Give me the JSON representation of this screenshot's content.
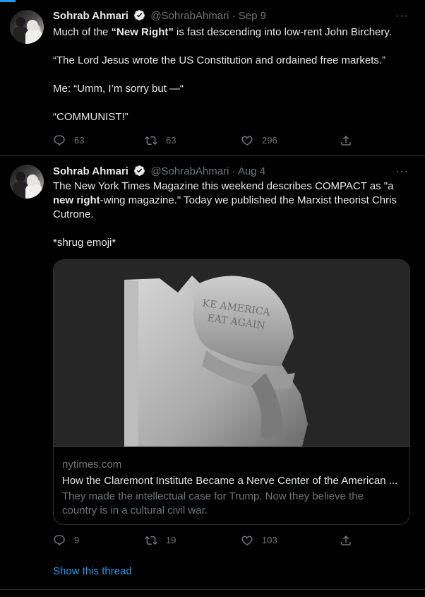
{
  "tweets": [
    {
      "author_name": "Sohrab Ahmari",
      "handle": "@SohrabAhmari",
      "separator": "·",
      "date": "Sep 9",
      "lines": [
        {
          "pre": "Much of the ",
          "bold": "“New Right”",
          "post": " is fast descending into low-rent John Birchery."
        },
        {
          "pre": "“The Lord Jesus wrote the US Constitution and ordained free markets.”",
          "bold": "",
          "post": ""
        },
        {
          "pre": "Me: “Umm, I’m sorry but —“",
          "bold": "",
          "post": ""
        },
        {
          "pre": "“COMMUNIST!”",
          "bold": "",
          "post": ""
        }
      ],
      "reply_count": "63",
      "retweet_count": "63",
      "like_count": "296"
    },
    {
      "author_name": "Sohrab Ahmari",
      "handle": "@SohrabAhmari",
      "separator": "·",
      "date": "Aug 4",
      "text_part1": "The New York Times Magazine this weekend describes COMPACT as \"a ",
      "text_bold": "new right",
      "text_part2": "-wing magazine.\" Today we published the Marxist theorist Chris Cutrone.",
      "text_line2": "*shrug emoji*",
      "card": {
        "image_caption": "KE AMERICA\nEAT AGAIN",
        "domain": "nytimes.com",
        "title": "How the Claremont Institute Became a Nerve Center of the American ...",
        "description": "They made the intellectual case for Trump. Now they believe the country is in a cultural civil war."
      },
      "reply_count": "9",
      "retweet_count": "19",
      "like_count": "103"
    }
  ],
  "show_thread_label": "Show this thread",
  "colors": {
    "background": "#000000",
    "text": "#e7e9ea",
    "muted": "#71767b",
    "accent": "#1d9bf0",
    "divider": "#2f3336"
  },
  "icons": {
    "verified": "verified-badge-icon",
    "more": "more-options-icon",
    "reply": "reply-icon",
    "retweet": "retweet-icon",
    "like": "heart-icon",
    "share": "share-icon"
  }
}
